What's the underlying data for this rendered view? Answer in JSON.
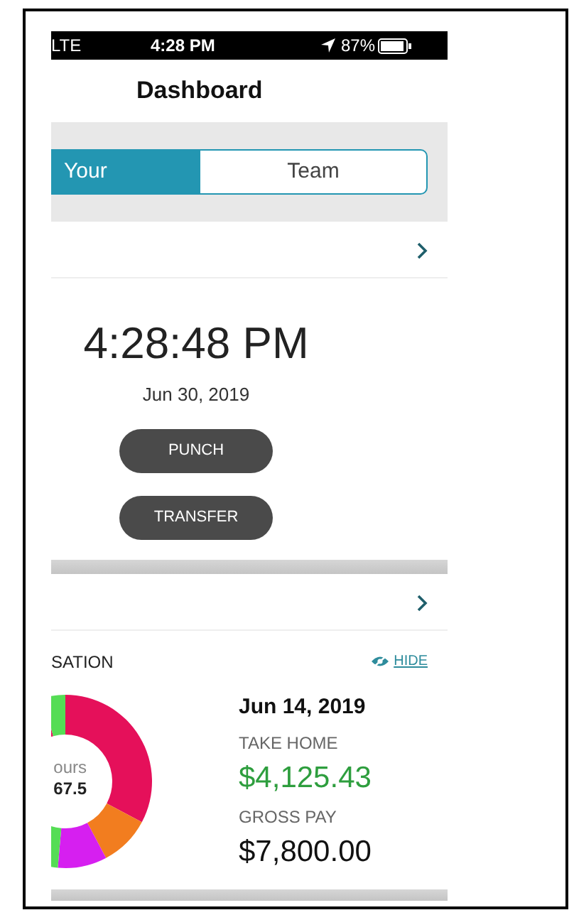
{
  "status_bar": {
    "carrier": "LTE",
    "time": "4:28 PM",
    "battery": "87%"
  },
  "header": {
    "title": "Dashboard"
  },
  "tabs": [
    {
      "label": "Your",
      "selected": true
    },
    {
      "label": "Team",
      "selected": false
    }
  ],
  "timecard": {
    "clock": "4:28:48 PM",
    "date": "Jun 30, 2019",
    "buttons": [
      "PUNCH",
      "TRANSFER"
    ]
  },
  "compensation": {
    "title": "SATION",
    "hide_link": "HIDE",
    "chart_center_label": "ours",
    "chart_center_value": "67.5",
    "pay_date": "Jun 14, 2019",
    "take_home_label": "TAKE HOME",
    "take_home": "$4,125.43",
    "gross_pay_label": "GROSS PAY",
    "gross_pay": "$7,800.00"
  }
}
